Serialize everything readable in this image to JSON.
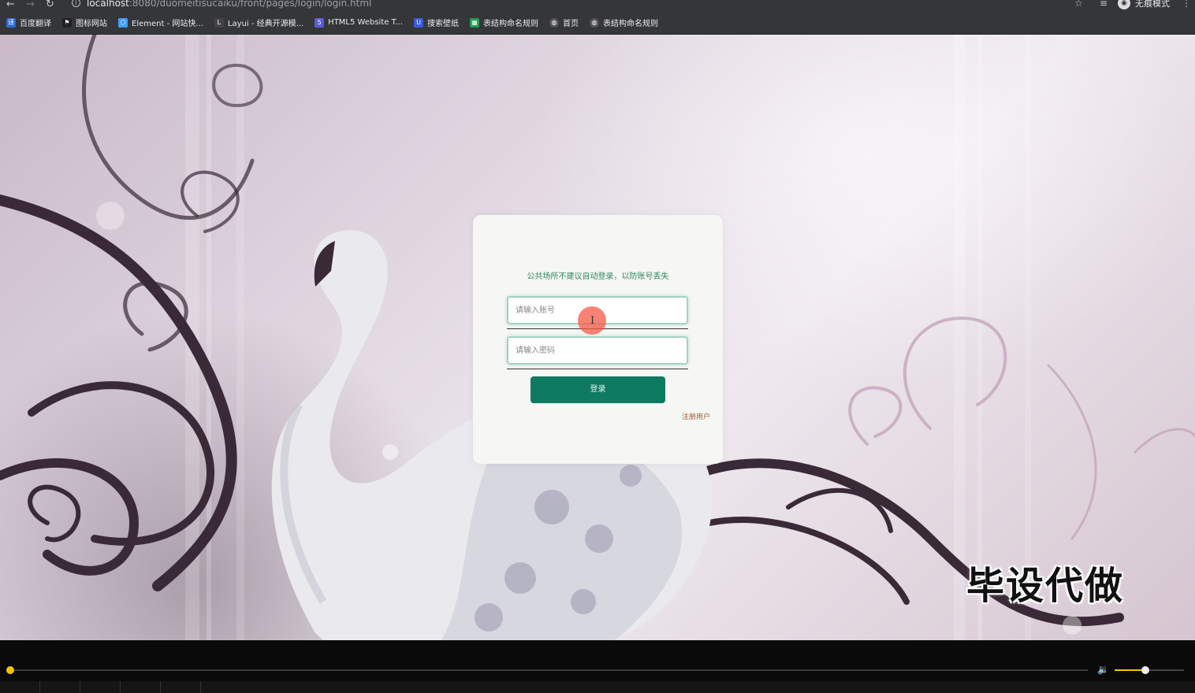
{
  "browser": {
    "url_host": "localhost",
    "url_path": ":8080/duomeitisucaiku/front/pages/login/login.html",
    "incognito_label": "无痕模式"
  },
  "bookmarks": [
    {
      "label": "百度翻译",
      "icon": "translate-icon",
      "color": "#2f6bd8"
    },
    {
      "label": "图标网站",
      "icon": "flag-icon",
      "color": "#222222"
    },
    {
      "label": "Element - 网站快...",
      "icon": "element-icon",
      "color": "#409eff"
    },
    {
      "label": "Layui - 经典开源模...",
      "icon": "layui-icon",
      "color": "#444444"
    },
    {
      "label": "HTML5 Website T...",
      "icon": "html5-icon",
      "color": "#5b5bd6"
    },
    {
      "label": "搜索壁纸",
      "icon": "wallpaper-icon",
      "color": "#3b5bdb"
    },
    {
      "label": "表结构命名规则",
      "icon": "sheet-icon",
      "color": "#1e9d55"
    },
    {
      "label": "首页",
      "icon": "globe-icon",
      "color": "#555555"
    },
    {
      "label": "表结构命名规则",
      "icon": "globe-icon",
      "color": "#555555"
    }
  ],
  "login": {
    "notice": "公共场所不建议自动登录，以防账号丢失",
    "username_placeholder": "请输入账号",
    "password_placeholder": "请输入密码",
    "login_button": "登录",
    "register_link": "注册用户"
  },
  "watermark": "毕设代做",
  "player": {
    "progress": 0.0,
    "volume": 0.45
  },
  "colors": {
    "accent": "#0f7a62",
    "notice": "#2d8a5c",
    "register": "#a05a2c",
    "player_accent": "#f5c400"
  }
}
